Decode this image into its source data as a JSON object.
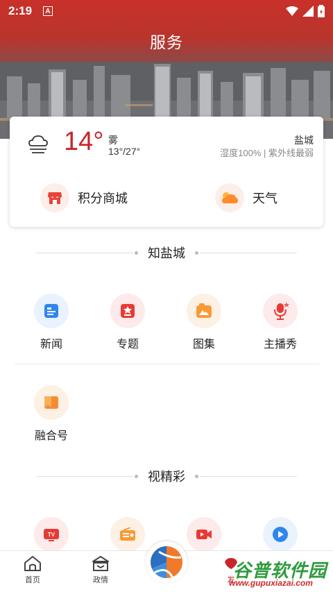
{
  "status_bar": {
    "time": "2:19",
    "badge": "A"
  },
  "header": {
    "title": "服务"
  },
  "weather": {
    "temperature": "14°",
    "condition": "雾",
    "range": "13°/27°",
    "city": "盐城",
    "details": "湿度100% | 紫外线最弱",
    "icon": "fog-cloud-icon"
  },
  "quick_links": [
    {
      "label": "积分商城",
      "icon": "shop-icon"
    },
    {
      "label": "天气",
      "icon": "weather-cloud-icon"
    }
  ],
  "sections": [
    {
      "title": "知盐城",
      "items": [
        {
          "label": "新闻",
          "icon": "news-icon"
        },
        {
          "label": "专题",
          "icon": "topic-icon"
        },
        {
          "label": "图集",
          "icon": "gallery-icon"
        },
        {
          "label": "主播秀",
          "icon": "microphone-icon"
        },
        {
          "label": "融合号",
          "icon": "bookmark-icon"
        }
      ]
    },
    {
      "title": "视精彩",
      "items": [
        {
          "label": "",
          "icon": "tv-icon"
        },
        {
          "label": "",
          "icon": "radio-icon"
        },
        {
          "label": "",
          "icon": "video-camera-icon"
        },
        {
          "label": "",
          "icon": "play-icon"
        }
      ]
    }
  ],
  "tab_bar": {
    "items": [
      {
        "label": "首页",
        "icon": "home-icon"
      },
      {
        "label": "政情",
        "icon": "government-icon"
      },
      {
        "label": "发",
        "icon": "publish-icon"
      }
    ],
    "center_icon": "app-logo-icon"
  },
  "watermark": {
    "text": "谷普软件园",
    "url": "www.gupuxiazai.com"
  },
  "colors": {
    "brand_red": "#c8262a",
    "accent_light": "#fdeee9"
  }
}
